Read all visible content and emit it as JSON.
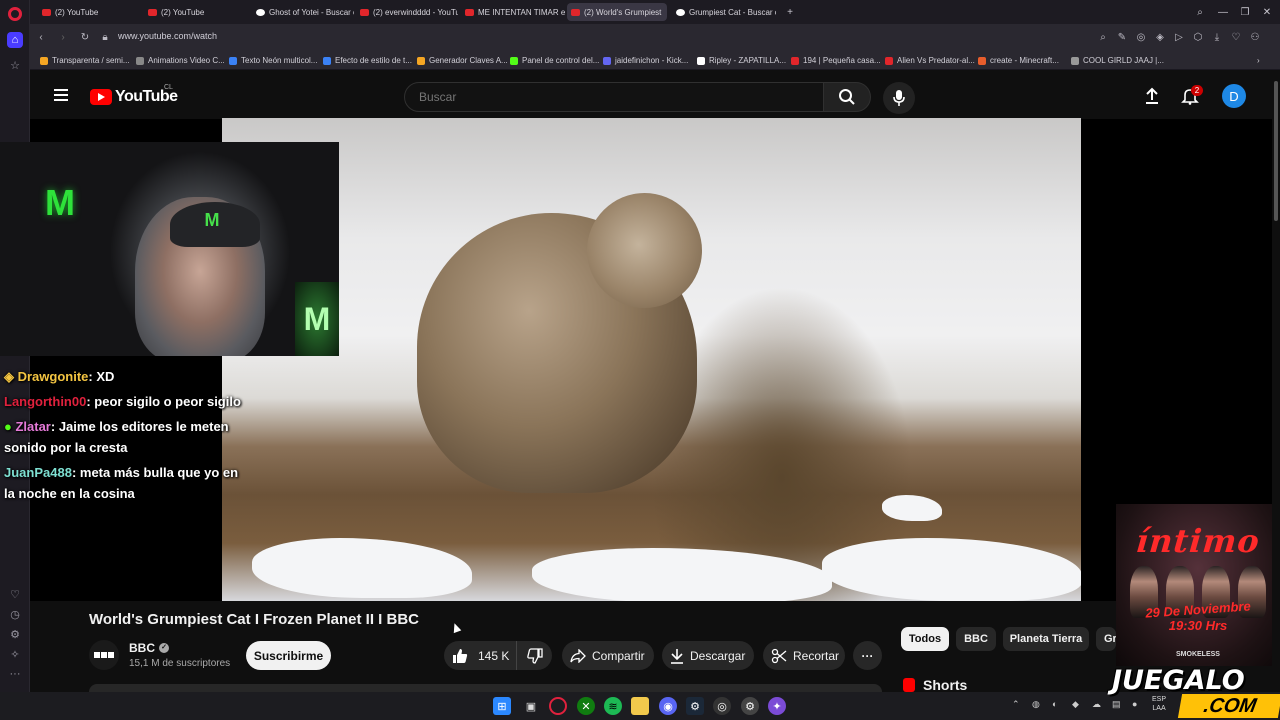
{
  "browser": {
    "tabs": [
      {
        "label": "(2) YouTube",
        "favicon": "youtube-icon"
      },
      {
        "label": "(2) YouTube",
        "favicon": "youtube-icon"
      },
      {
        "label": "Ghost of Yotei - Buscar co",
        "favicon": "google-icon"
      },
      {
        "label": "(2) everwindddd - YouTu",
        "favicon": "youtube-icon"
      },
      {
        "label": "ME INTENTAN TIMAR en",
        "favicon": "youtube-icon"
      },
      {
        "label": "(2) World's Grumpiest",
        "favicon": "youtube-icon",
        "active": true
      },
      {
        "label": "Grumpiest Cat - Buscar co",
        "favicon": "google-icon"
      }
    ],
    "url": "www.youtube.com/watch",
    "bookmarks": [
      {
        "label": "Transparenta / semi...",
        "color": "#f5a623"
      },
      {
        "label": "Animations Video C...",
        "color": "#888888"
      },
      {
        "label": "Texto Neón multicol...",
        "color": "#3b82f6"
      },
      {
        "label": "Efecto de estilo de t...",
        "color": "#3b82f6"
      },
      {
        "label": "Generador Claves A...",
        "color": "#f5a623"
      },
      {
        "label": "Panel de control del...",
        "color": "#53fc18"
      },
      {
        "label": "jaidefinichon - Kick...",
        "color": "#6366f1"
      },
      {
        "label": "Ripley - ZAPATILLA...",
        "color": "#ffffff"
      },
      {
        "label": "194 | Pequeña casa...",
        "color": "#e1262b"
      },
      {
        "label": "Alien Vs Predator-al...",
        "color": "#e1262b"
      },
      {
        "label": "create - Minecraft...",
        "color": "#e85d2c"
      },
      {
        "label": "COOL GIRLD JAAJ |...",
        "color": "#999999"
      }
    ]
  },
  "youtube": {
    "country": "CL",
    "logo_text": "YouTube",
    "search_placeholder": "Buscar",
    "notification_count": "2",
    "avatar_letter": "D",
    "video_title": "World's Grumpiest Cat I Frozen Planet II I BBC",
    "channel_name": "BBC",
    "subscribers": "15,1 M de suscriptores",
    "subscribe_label": "Suscribirme",
    "like_count": "145 K",
    "share_label": "Compartir",
    "download_label": "Descargar",
    "clip_label": "Recortar",
    "more_label": "···",
    "chips": [
      "Todos",
      "BBC",
      "Planeta Tierra",
      "Gr"
    ],
    "shorts_label": "Shorts"
  },
  "stream_overlay": {
    "chat": [
      {
        "user": "Drawgonite",
        "user_color": "#f4c542",
        "message": ": XD"
      },
      {
        "user": "Langorthin00",
        "user_color": "#e0213d",
        "message": ": peor sigilo o peor sigilo"
      },
      {
        "user": "Zlatar",
        "user_color": "#e57ad8",
        "message": ": Jaime los editores le meten",
        "message2": "sonido por la cresta"
      },
      {
        "user": "JuanPa488",
        "user_color": "#7ee0d2",
        "message": ": meta más bulla que yo en",
        "message2": "la noche en la cosina"
      }
    ],
    "promo": {
      "title": "íntimo",
      "date": "29 De Noviembre",
      "time": "19:30 Hrs",
      "brand": "SMOKELESS"
    },
    "watermark": "JUEGALO",
    "watermark_sub": ".COM"
  },
  "taskbar": {
    "lang": "ESP",
    "lang2": "LAA"
  }
}
